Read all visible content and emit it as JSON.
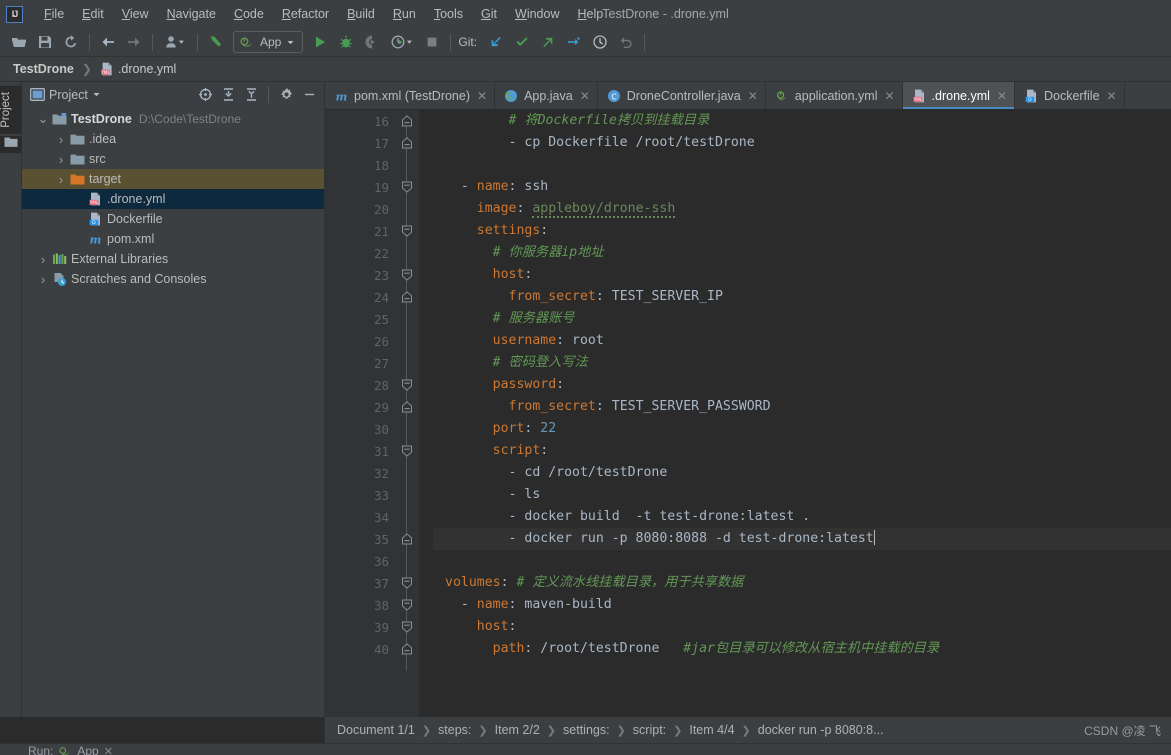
{
  "window": {
    "title": "TestDrone - .drone.yml",
    "logo": "IJ"
  },
  "menubar": {
    "items": [
      {
        "label": "File",
        "mnemonic": "F"
      },
      {
        "label": "Edit",
        "mnemonic": "E"
      },
      {
        "label": "View",
        "mnemonic": "V"
      },
      {
        "label": "Navigate",
        "mnemonic": "N"
      },
      {
        "label": "Code",
        "mnemonic": "C"
      },
      {
        "label": "Refactor",
        "mnemonic": "R"
      },
      {
        "label": "Build",
        "mnemonic": "B"
      },
      {
        "label": "Run",
        "mnemonic": "R"
      },
      {
        "label": "Tools",
        "mnemonic": "T"
      },
      {
        "label": "Git",
        "mnemonic": "G"
      },
      {
        "label": "Window",
        "mnemonic": "W"
      },
      {
        "label": "Help",
        "mnemonic": "H"
      }
    ]
  },
  "toolbar": {
    "open_icon": "open-folder-icon",
    "save_icon": "save-icon",
    "sync_icon": "sync-icon",
    "back_icon": "arrow-back-icon",
    "forward_icon": "arrow-forward-icon",
    "profile_icon": "user-profile-icon",
    "update_icon": "update-project-icon",
    "run_config_label": "App",
    "run_icon": "run-icon",
    "debug_icon": "debug-icon",
    "run_coverage_icon": "run-with-coverage-icon",
    "profiler_icon": "profiler-icon",
    "stop_icon": "stop-icon",
    "git_label": "Git:",
    "git_update_icon": "git-update-icon",
    "git_commit_icon": "git-commit-icon",
    "git_push_icon": "git-push-icon",
    "git_branch_icon": "git-branch-icon",
    "history_icon": "history-icon",
    "rollback_icon": "rollback-icon"
  },
  "navbar": {
    "crumbs": [
      {
        "label": "TestDrone",
        "icon": "project-icon"
      },
      {
        "label": ".drone.yml",
        "icon": "yml-file-icon"
      }
    ]
  },
  "left_strip": {
    "project_label": "Project"
  },
  "project_panel": {
    "title": "Project",
    "tools": [
      {
        "name": "select-opened-file-icon"
      },
      {
        "name": "expand-all-icon"
      },
      {
        "name": "collapse-all-icon"
      },
      {
        "name": "settings-gear-icon"
      },
      {
        "name": "hide-panel-icon"
      }
    ],
    "tree": [
      {
        "label": "TestDrone",
        "path": "D:\\Code\\TestDrone",
        "indent": 0,
        "arrow": "expanded",
        "icon": "module-icon",
        "bold": true,
        "state": "none"
      },
      {
        "label": ".idea",
        "path": "",
        "indent": 1,
        "arrow": "collapsed",
        "icon": "folder-icon",
        "bold": false,
        "state": "none"
      },
      {
        "label": "src",
        "path": "",
        "indent": 1,
        "arrow": "collapsed",
        "icon": "folder-icon",
        "bold": false,
        "state": "none"
      },
      {
        "label": "target",
        "path": "",
        "indent": 1,
        "arrow": "collapsed",
        "icon": "folder-orange-icon",
        "bold": false,
        "state": "sel-inactive"
      },
      {
        "label": ".drone.yml",
        "path": "",
        "indent": 2,
        "arrow": "none",
        "icon": "yml-file-icon",
        "bold": false,
        "state": "sel-active"
      },
      {
        "label": "Dockerfile",
        "path": "",
        "indent": 2,
        "arrow": "none",
        "icon": "docker-file-icon",
        "bold": false,
        "state": "none"
      },
      {
        "label": "pom.xml",
        "path": "",
        "indent": 2,
        "arrow": "none",
        "icon": "maven-icon",
        "bold": false,
        "state": "none"
      },
      {
        "label": "External Libraries",
        "path": "",
        "indent": 0,
        "arrow": "collapsed",
        "icon": "libraries-icon",
        "bold": false,
        "state": "none"
      },
      {
        "label": "Scratches and Consoles",
        "path": "",
        "indent": 0,
        "arrow": "collapsed",
        "icon": "scratches-icon",
        "bold": false,
        "state": "none"
      }
    ]
  },
  "editor_tabs": [
    {
      "label": "pom.xml (TestDrone)",
      "icon": "maven-icon",
      "active": false
    },
    {
      "label": "App.java",
      "icon": "spring-class-icon",
      "active": false
    },
    {
      "label": "DroneController.java",
      "icon": "java-class-icon",
      "active": false
    },
    {
      "label": "application.yml",
      "icon": "spring-yml-icon",
      "active": false
    },
    {
      "label": ".drone.yml",
      "icon": "yml-file-icon",
      "active": true
    },
    {
      "label": "Dockerfile",
      "icon": "docker-file-icon",
      "active": false
    }
  ],
  "code": {
    "first_line": 16,
    "lines": [
      {
        "n": 16,
        "fold": "end",
        "tokens": [
          {
            "t": "        ",
            "c": "s"
          },
          {
            "t": "# 将Dockerfile拷贝到挂载目录",
            "c": "cm"
          }
        ]
      },
      {
        "n": 17,
        "fold": "end",
        "tokens": [
          {
            "t": "        - cp Dockerfile /root/testDrone",
            "c": "s"
          }
        ]
      },
      {
        "n": 18,
        "fold": "none",
        "tokens": []
      },
      {
        "n": 19,
        "fold": "start",
        "tokens": [
          {
            "t": "  - ",
            "c": "s"
          },
          {
            "t": "name",
            "c": "k"
          },
          {
            "t": ": ssh",
            "c": "s"
          }
        ]
      },
      {
        "n": 20,
        "fold": "none",
        "tokens": [
          {
            "t": "    ",
            "c": "s"
          },
          {
            "t": "image",
            "c": "k"
          },
          {
            "t": ": ",
            "c": "s"
          },
          {
            "t": "appleboy/drone-ssh",
            "c": "v typo"
          }
        ]
      },
      {
        "n": 21,
        "fold": "start",
        "tokens": [
          {
            "t": "    ",
            "c": "s"
          },
          {
            "t": "settings",
            "c": "k"
          },
          {
            "t": ":",
            "c": "s"
          }
        ]
      },
      {
        "n": 22,
        "fold": "none",
        "tokens": [
          {
            "t": "      ",
            "c": "s"
          },
          {
            "t": "# 你服务器ip地址",
            "c": "cm"
          }
        ]
      },
      {
        "n": 23,
        "fold": "start",
        "tokens": [
          {
            "t": "      ",
            "c": "s"
          },
          {
            "t": "host",
            "c": "k"
          },
          {
            "t": ":",
            "c": "s"
          }
        ]
      },
      {
        "n": 24,
        "fold": "end",
        "tokens": [
          {
            "t": "        ",
            "c": "s"
          },
          {
            "t": "from_secret",
            "c": "k"
          },
          {
            "t": ": TEST_SERVER_IP",
            "c": "s"
          }
        ]
      },
      {
        "n": 25,
        "fold": "none",
        "tokens": [
          {
            "t": "      ",
            "c": "s"
          },
          {
            "t": "# 服务器账号",
            "c": "cm"
          }
        ]
      },
      {
        "n": 26,
        "fold": "none",
        "tokens": [
          {
            "t": "      ",
            "c": "s"
          },
          {
            "t": "username",
            "c": "k"
          },
          {
            "t": ": root",
            "c": "s"
          }
        ]
      },
      {
        "n": 27,
        "fold": "none",
        "tokens": [
          {
            "t": "      ",
            "c": "s"
          },
          {
            "t": "# 密码登入写法",
            "c": "cm"
          }
        ]
      },
      {
        "n": 28,
        "fold": "start",
        "tokens": [
          {
            "t": "      ",
            "c": "s"
          },
          {
            "t": "password",
            "c": "k"
          },
          {
            "t": ":",
            "c": "s"
          }
        ]
      },
      {
        "n": 29,
        "fold": "end",
        "tokens": [
          {
            "t": "        ",
            "c": "s"
          },
          {
            "t": "from_secret",
            "c": "k"
          },
          {
            "t": ": TEST_SERVER_PASSWORD",
            "c": "s"
          }
        ]
      },
      {
        "n": 30,
        "fold": "none",
        "tokens": [
          {
            "t": "      ",
            "c": "s"
          },
          {
            "t": "port",
            "c": "k"
          },
          {
            "t": ": ",
            "c": "s"
          },
          {
            "t": "22",
            "c": "n"
          }
        ]
      },
      {
        "n": 31,
        "fold": "start",
        "tokens": [
          {
            "t": "      ",
            "c": "s"
          },
          {
            "t": "script",
            "c": "k"
          },
          {
            "t": ":",
            "c": "s"
          }
        ]
      },
      {
        "n": 32,
        "fold": "none",
        "tokens": [
          {
            "t": "        - cd /root/testDrone",
            "c": "s"
          }
        ]
      },
      {
        "n": 33,
        "fold": "none",
        "tokens": [
          {
            "t": "        - ls",
            "c": "s"
          }
        ]
      },
      {
        "n": 34,
        "fold": "none",
        "tokens": [
          {
            "t": "        - docker build  -t test-drone:latest .",
            "c": "s"
          }
        ]
      },
      {
        "n": 35,
        "fold": "end",
        "current": true,
        "caret": true,
        "tokens": [
          {
            "t": "        - docker run -p 8080:8088 -d test-drone:latest",
            "c": "s"
          }
        ]
      },
      {
        "n": 36,
        "fold": "none",
        "tokens": []
      },
      {
        "n": 37,
        "fold": "start",
        "tokens": [
          {
            "t": "volumes",
            "c": "k"
          },
          {
            "t": ": ",
            "c": "s"
          },
          {
            "t": "# 定义流水线挂载目录，用于共享数据",
            "c": "cm"
          }
        ]
      },
      {
        "n": 38,
        "fold": "start",
        "tokens": [
          {
            "t": "  - ",
            "c": "s"
          },
          {
            "t": "name",
            "c": "k"
          },
          {
            "t": ": maven-build",
            "c": "s"
          }
        ]
      },
      {
        "n": 39,
        "fold": "start",
        "tokens": [
          {
            "t": "    ",
            "c": "s"
          },
          {
            "t": "host",
            "c": "k"
          },
          {
            "t": ":",
            "c": "s"
          }
        ]
      },
      {
        "n": 40,
        "fold": "end",
        "tokens": [
          {
            "t": "      ",
            "c": "s"
          },
          {
            "t": "path",
            "c": "k"
          },
          {
            "t": ": /root/testDrone   ",
            "c": "s"
          },
          {
            "t": "#jar包目录可以修改从宿主机中挂载的目录",
            "c": "cm"
          }
        ]
      }
    ]
  },
  "bottom_breadcrumb": [
    "Document 1/1",
    "steps:",
    "Item 2/2",
    "settings:",
    "script:",
    "Item 4/4",
    "docker run -p 8080:8..."
  ],
  "watermark": "CSDN @凌 飞",
  "status_bar": {
    "run_label": "Run:",
    "run_config": "App",
    "run_icon": "spring-run-icon"
  },
  "colors": {
    "accent": "#4a88c7",
    "panel_bg": "#3c3f41",
    "editor_bg": "#2b2b2b",
    "gutter_bg": "#313335",
    "selection_active": "#0d293e",
    "selection_inactive": "#5a5132",
    "keyword": "#cc7832",
    "comment": "#629755",
    "string": "#6a8759",
    "number": "#6897bb",
    "text": "#a9b7c6"
  }
}
